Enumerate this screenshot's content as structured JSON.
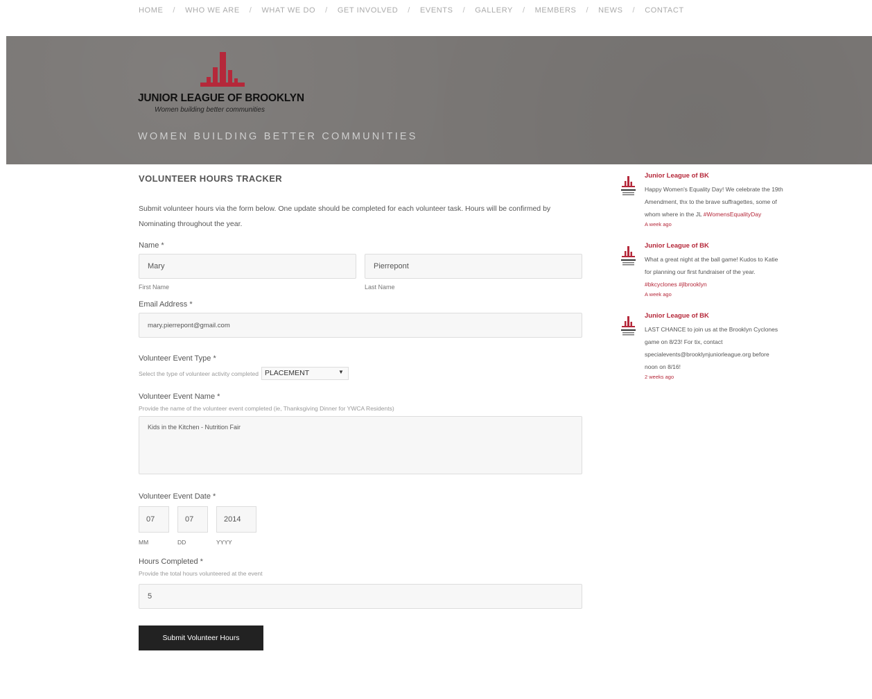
{
  "nav": {
    "items": [
      "HOME",
      "WHO WE ARE",
      "WHAT WE DO",
      "GET INVOLVED",
      "EVENTS",
      "GALLERY",
      "MEMBERS",
      "NEWS",
      "CONTACT"
    ],
    "separator": "/"
  },
  "header": {
    "logo_name": "JUNIOR LEAGUE OF BROOKLYN",
    "logo_tagline": "Women building better communities",
    "tagline": "WOMEN BUILDING BETTER COMMUNITIES"
  },
  "form": {
    "title": "VOLUNTEER HOURS TRACKER",
    "intro": "Submit volunteer hours via the form below. One update should be completed for each volunteer task. Hours will be confirmed by Nominating throughout the year.",
    "name": {
      "label": "Name",
      "required": "*",
      "first_value": "Mary",
      "last_value": "Pierrepont",
      "first_hint": "First Name",
      "last_hint": "Last Name"
    },
    "email": {
      "label": "Email Address",
      "required": "*",
      "value": "mary.pierrepont@gmail.com"
    },
    "event_type": {
      "label": "Volunteer Event Type",
      "required": "*",
      "description": "Select the type of volunteer activity completed",
      "selected": "PLACEMENT"
    },
    "event_name": {
      "label": "Volunteer Event Name",
      "required": "*",
      "description": "Provide the name of the volunteer event completed (ie, Thanksgiving Dinner for YWCA Residents)",
      "value": "Kids in the Kitchen - Nutrition Fair"
    },
    "event_date": {
      "label": "Volunteer Event Date",
      "required": "*",
      "mm": "07",
      "dd": "07",
      "yyyy": "2014",
      "mm_hint": "MM",
      "dd_hint": "DD",
      "yyyy_hint": "YYYY"
    },
    "hours": {
      "label": "Hours Completed",
      "required": "*",
      "description": "Provide the total hours volunteered at the event",
      "value": "5"
    },
    "submit_label": "Submit Volunteer Hours"
  },
  "sidebar": {
    "tweets": [
      {
        "author": "Junior League of BK",
        "text": "Happy Women's Equality Day! We celebrate the 19th Amendment, thx to the brave suffragettes, some of whom where in the JL",
        "tags": "#WomensEqualityDay",
        "time": "A week ago"
      },
      {
        "author": "Junior League of BK",
        "text": "What a great night at the ball game! Kudos to Katie for planning our first fundraiser of the year.",
        "tags": "#bkcyclones #jlbrooklyn",
        "time": "A week ago"
      },
      {
        "author": "Junior League of BK",
        "text": "LAST CHANCE to join us at the Brooklyn Cyclones game on 8/23! For tix, contact specialevents@brooklynjuniorleague.org before noon on 8/16!",
        "tags": "",
        "time": "2 weeks ago"
      }
    ]
  },
  "colors": {
    "brand_red": "#b5283a",
    "banner_gray": "#7a7775",
    "button_dark": "#222222"
  }
}
